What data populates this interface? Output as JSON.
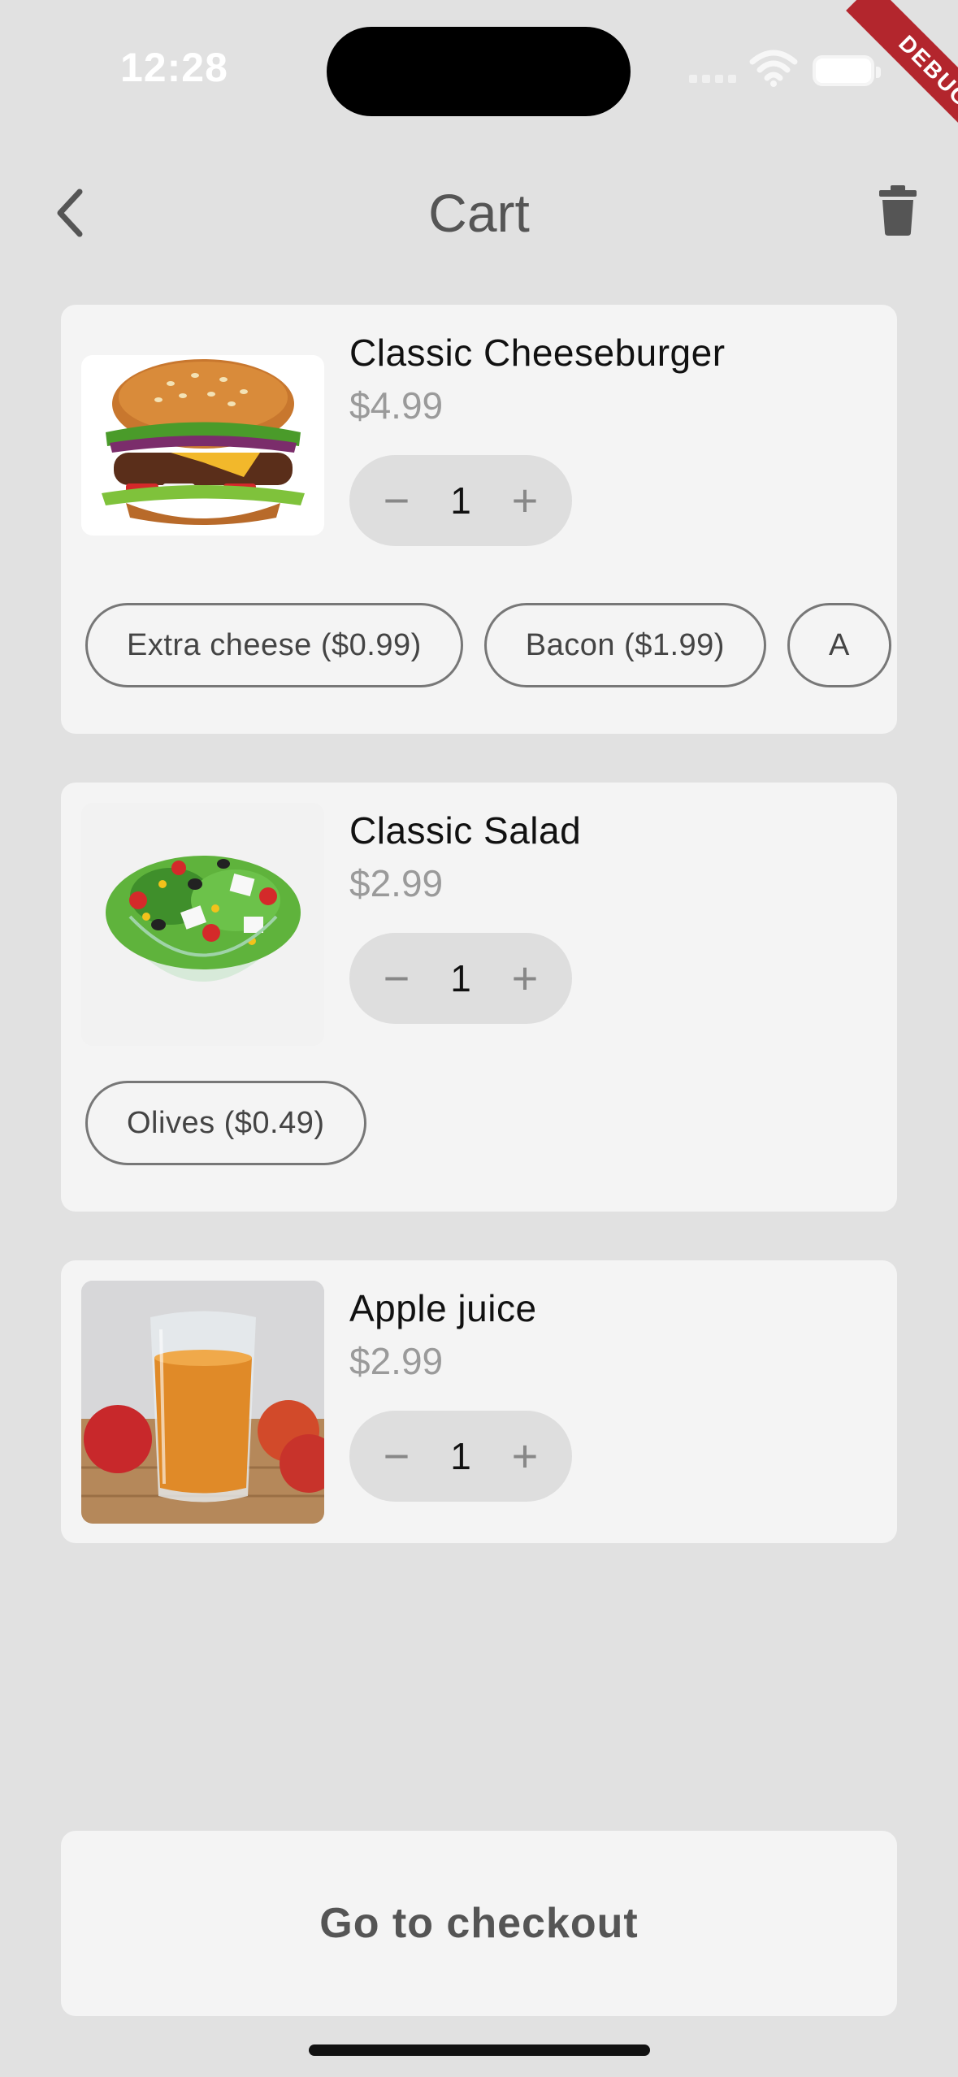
{
  "status_bar": {
    "time": "12:28",
    "debug_label": "DEBUG"
  },
  "header": {
    "title": "Cart"
  },
  "cart": {
    "items": [
      {
        "name": "Classic Cheeseburger",
        "price": "$4.99",
        "quantity": "1",
        "image": "cheeseburger-photo",
        "extras": [
          "Extra cheese ($0.99)",
          "Bacon ($1.99)",
          "A"
        ]
      },
      {
        "name": "Classic Salad",
        "price": "$2.99",
        "quantity": "1",
        "image": "salad-photo",
        "extras": [
          "Olives ($0.49)"
        ]
      },
      {
        "name": "Apple juice",
        "price": "$2.99",
        "quantity": "1",
        "image": "apple-juice-photo",
        "extras": []
      }
    ]
  },
  "icons": {
    "decrement": "−",
    "increment": "+"
  },
  "footer": {
    "checkout_label": "Go to checkout"
  },
  "colors": {
    "background": "#e1e1e1",
    "card": "#f4f4f4",
    "price": "#9a9a9a",
    "debug_ribbon": "#b3262d"
  }
}
